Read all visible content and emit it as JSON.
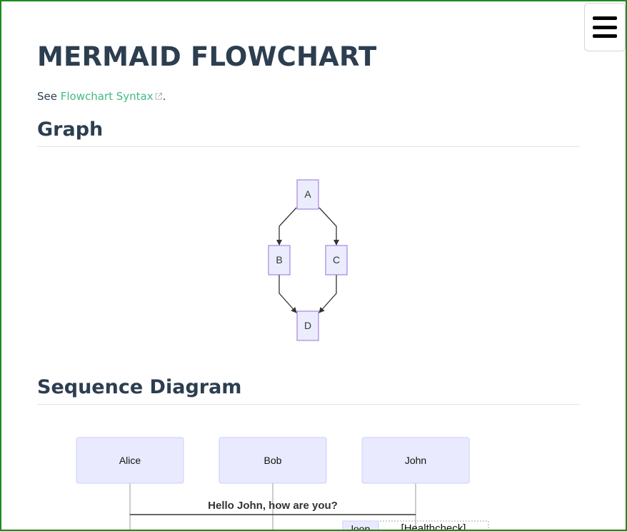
{
  "page": {
    "title": "MERMAID FLOWCHART",
    "see_prefix": "See ",
    "see_link": "Flowchart Syntax",
    "see_suffix": "."
  },
  "menu": {
    "icon": "hamburger-menu-icon"
  },
  "sections": {
    "graph_heading": "Graph",
    "sequence_heading": "Sequence Diagram"
  },
  "flowchart": {
    "nodes": {
      "a": "A",
      "b": "B",
      "c": "C",
      "d": "D"
    },
    "edges": [
      [
        "A",
        "B"
      ],
      [
        "A",
        "C"
      ],
      [
        "B",
        "D"
      ],
      [
        "C",
        "D"
      ]
    ],
    "colors": {
      "node_fill": "#ececff",
      "node_stroke": "#9370db",
      "edge": "#333333"
    }
  },
  "sequence": {
    "participants": {
      "alice": "Alice",
      "bob": "Bob",
      "john": "John"
    },
    "message_1": "Hello John, how are you?",
    "loop_label": "loop",
    "loop_condition": "[Healthcheck]",
    "colors": {
      "actor_fill": "#eaeaff",
      "actor_stroke": "#ccccff"
    }
  },
  "colors": {
    "heading": "#2c3e50",
    "link": "#42b983",
    "frame_border": "#1e8a1e"
  }
}
